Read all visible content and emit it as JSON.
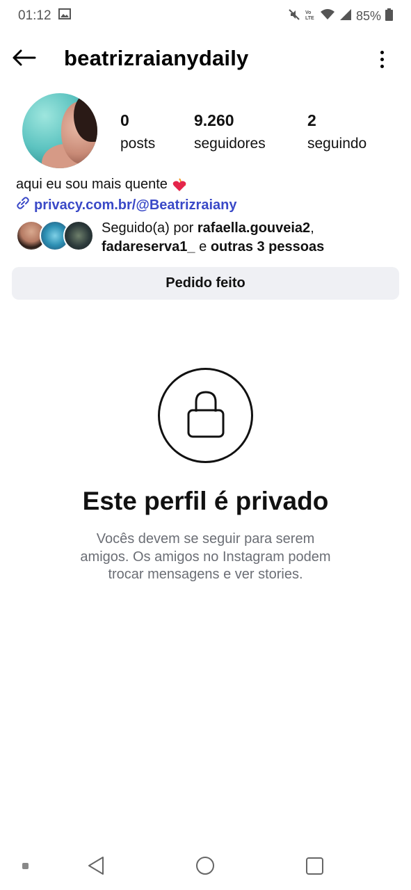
{
  "status_bar": {
    "time": "01:12",
    "battery": "85%",
    "icons": [
      "image-icon",
      "mute-icon",
      "volte-icon",
      "wifi-icon",
      "signal-icon",
      "battery-icon"
    ]
  },
  "header": {
    "username": "beatrizraianydaily",
    "icons": [
      "back-arrow-icon",
      "more-options-icon"
    ]
  },
  "profile": {
    "stats": [
      {
        "value": "0",
        "label": "posts"
      },
      {
        "value": "9.260",
        "label": "seguidores"
      },
      {
        "value": "2",
        "label": "seguindo"
      }
    ],
    "bio": "aqui eu sou mais quente",
    "bio_emoji": "heart-on-fire-icon",
    "link": "privacy.com.br/@Beatrizraiany",
    "followed_by": {
      "prefix": "Seguido(a) por ",
      "user1": "rafaella.gouveia2",
      "sep": ",",
      "user2": "fadareserva1_",
      "conj": " e ",
      "others": "outras 3 pessoas"
    },
    "request_button": "Pedido feito"
  },
  "private": {
    "title": "Este perfil é privado",
    "description": "Vocês devem se seguir para serem amigos. Os amigos no Instagram podem trocar mensagens e ver stories."
  },
  "colors": {
    "link": "#3a49c7",
    "button_bg": "#eff0f4",
    "muted_text": "#6b6e75"
  }
}
